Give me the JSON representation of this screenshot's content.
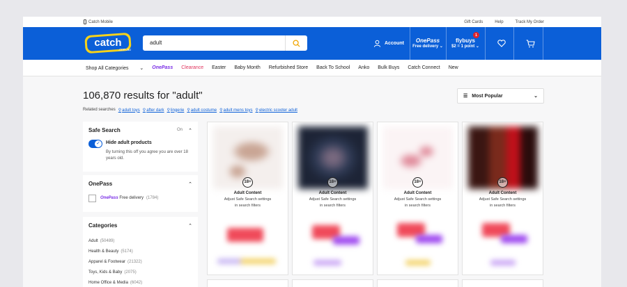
{
  "utility": {
    "mobile": "Catch Mobile",
    "links": [
      "Gift Cards",
      "Help",
      "Track My Order"
    ]
  },
  "header": {
    "logo": "catch",
    "logo_sub": ".com.au",
    "search_value": "adult",
    "account": "Account",
    "onepass_brand": "OnePass",
    "onepass_sub": "Free delivery ⌄",
    "flybuys_brand": "flybuys",
    "flybuys_sub": "$2 = 1 point ⌄",
    "flybuys_badge": "1",
    "colors": {
      "primary": "#0b5fd8",
      "onepass": "#7a2ee6",
      "clearance": "#e0335c"
    }
  },
  "catnav": {
    "shop_all": "Shop All Categories",
    "onepass": "OnePass",
    "clearance": "Clearance",
    "items": [
      "Easter",
      "Baby Month",
      "Refurbished Store",
      "Back To School",
      "Anko",
      "Bulk Buys",
      "Catch Connect",
      "New"
    ]
  },
  "results": {
    "title": "106,870 results for \"adult\"",
    "related_label": "Related searches"
  },
  "related": [
    "adult toys",
    "after dark",
    "lingerie",
    "adult costume",
    "adult mens toys",
    "electric scooter adult"
  ],
  "sort": {
    "label": "Most Popular"
  },
  "filters": {
    "safe_search": {
      "title": "Safe Search",
      "state": "On",
      "toggle_label": "Hide adult products",
      "desc": "By turning this off you agree you are over 18 years old."
    },
    "onepass": {
      "title": "OnePass",
      "brand": "OnePass",
      "label": "Free delivery",
      "count": "(1784)"
    },
    "categories": {
      "title": "Categories",
      "items": [
        {
          "name": "Adult",
          "count": "(50489)"
        },
        {
          "name": "Health & Beauty",
          "count": "(5174)"
        },
        {
          "name": "Apparel & Footwear",
          "count": "(21322)"
        },
        {
          "name": "Toys, Kids & Baby",
          "count": "(2075)"
        },
        {
          "name": "Home Office & Media",
          "count": "(6042)"
        }
      ]
    }
  },
  "products": [
    {
      "badge": "18+",
      "title": "Adult Content",
      "desc1": "Adjust Safe Search settings",
      "desc2": "in search filters"
    },
    {
      "badge": "18+",
      "title": "Adult Content",
      "desc1": "Adjust Safe Search settings",
      "desc2": "in search filters"
    },
    {
      "badge": "18+",
      "title": "Adult Content",
      "desc1": "Adjust Safe Search settings",
      "desc2": "in search filters"
    },
    {
      "badge": "18+",
      "title": "Adult Content",
      "desc1": "Adjust Safe Search settings",
      "desc2": "in search filters"
    }
  ]
}
